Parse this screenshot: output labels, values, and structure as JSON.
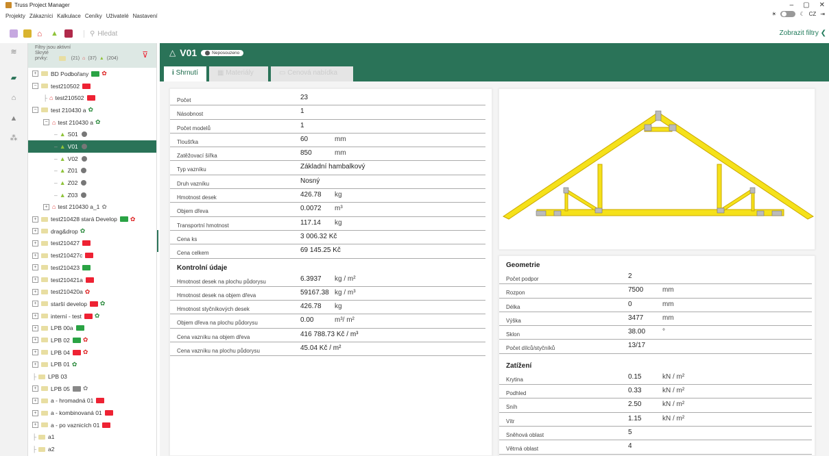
{
  "window": {
    "title": "Truss Project Manager",
    "min": "–",
    "max": "▢",
    "close": "✕"
  },
  "menu": [
    "Projekty",
    "Zákazníci",
    "Kalkulace",
    "Ceníky",
    "Uživatelé",
    "Nastavení"
  ],
  "menu_right": {
    "lang": "CZ"
  },
  "search": {
    "placeholder": "Hledat"
  },
  "filters_button": "Zobrazit filtry",
  "filter": {
    "line1": "Filtry jsou aktivní",
    "line2": "Skryté",
    "line3": "prvky:",
    "c1": "(21)",
    "c2": "(37)",
    "c3": "(204)"
  },
  "tree": [
    {
      "label": "BD Podbořany",
      "depth": 0,
      "type": "folder",
      "pm": "+",
      "badges": [
        "g",
        "gear-r"
      ]
    },
    {
      "label": "test210502",
      "depth": 0,
      "type": "folder",
      "pm": "−",
      "badges": [
        "r"
      ]
    },
    {
      "label": "test210502",
      "depth": 1,
      "type": "house",
      "pm": "",
      "badges": [
        "r"
      ]
    },
    {
      "label": "test 210430 a",
      "depth": 0,
      "type": "folder",
      "pm": "−",
      "badges": [
        "gear"
      ]
    },
    {
      "label": "test 210430 a",
      "depth": 1,
      "type": "house",
      "pm": "−",
      "badges": [
        "gear"
      ]
    },
    {
      "label": "S01",
      "depth": 2,
      "type": "tri",
      "pm": "",
      "badges": [
        "dot"
      ]
    },
    {
      "label": "V01",
      "depth": 2,
      "type": "tri",
      "pm": "",
      "badges": [
        "dot"
      ],
      "selected": true
    },
    {
      "label": "V02",
      "depth": 2,
      "type": "tri",
      "pm": "",
      "badges": [
        "dot"
      ]
    },
    {
      "label": "Z01",
      "depth": 2,
      "type": "tri",
      "pm": "",
      "badges": [
        "dot"
      ]
    },
    {
      "label": "Z02",
      "depth": 2,
      "type": "tri",
      "pm": "",
      "badges": [
        "dot"
      ]
    },
    {
      "label": "Z03",
      "depth": 2,
      "type": "tri",
      "pm": "",
      "badges": [
        "dot"
      ]
    },
    {
      "label": "test 210430 a_1",
      "depth": 1,
      "type": "house",
      "pm": "+",
      "badges": [
        "gear-gr"
      ]
    },
    {
      "label": "test210428 stará Develop",
      "depth": 0,
      "type": "folder",
      "pm": "+",
      "badges": [
        "g",
        "gear-r"
      ]
    },
    {
      "label": "drag&drop",
      "depth": 0,
      "type": "folder",
      "pm": "+",
      "badges": [
        "gear"
      ]
    },
    {
      "label": "test210427",
      "depth": 0,
      "type": "folder",
      "pm": "+",
      "badges": [
        "r"
      ]
    },
    {
      "label": "test210427c",
      "depth": 0,
      "type": "folder",
      "pm": "+",
      "badges": [
        "r"
      ]
    },
    {
      "label": "test210423",
      "depth": 0,
      "type": "folder",
      "pm": "+",
      "badges": [
        "g"
      ]
    },
    {
      "label": "test210421a",
      "depth": 0,
      "type": "folder",
      "pm": "+",
      "badges": [
        "r"
      ]
    },
    {
      "label": "test210420a",
      "depth": 0,
      "type": "folder",
      "pm": "+",
      "badges": [
        "gear-r"
      ]
    },
    {
      "label": "starší develop",
      "depth": 0,
      "type": "folder",
      "pm": "+",
      "badges": [
        "r",
        "gear"
      ]
    },
    {
      "label": "interní - test",
      "depth": 0,
      "type": "folder",
      "pm": "+",
      "badges": [
        "r",
        "gear"
      ]
    },
    {
      "label": "LPB 00a",
      "depth": 0,
      "type": "folder",
      "pm": "+",
      "badges": [
        "g"
      ]
    },
    {
      "label": "LPB 02",
      "depth": 0,
      "type": "folder",
      "pm": "+",
      "badges": [
        "g",
        "gear-r"
      ]
    },
    {
      "label": "LPB 04",
      "depth": 0,
      "type": "folder",
      "pm": "+",
      "badges": [
        "r",
        "gear-r"
      ]
    },
    {
      "label": "LPB 01",
      "depth": 0,
      "type": "folder",
      "pm": "+",
      "badges": [
        "gear"
      ]
    },
    {
      "label": "LPB 03",
      "depth": 0,
      "type": "folder",
      "pm": "",
      "badges": []
    },
    {
      "label": "LPB 05",
      "depth": 0,
      "type": "folder",
      "pm": "+",
      "badges": [
        "gr",
        "gear-gr"
      ]
    },
    {
      "label": "a - hromadná 01",
      "depth": 0,
      "type": "folder",
      "pm": "+",
      "badges": [
        "r"
      ]
    },
    {
      "label": "a - kombinovaná 01",
      "depth": 0,
      "type": "folder",
      "pm": "+",
      "badges": [
        "r"
      ]
    },
    {
      "label": "a - po vaznicích 01",
      "depth": 0,
      "type": "folder",
      "pm": "+",
      "badges": [
        "r"
      ]
    },
    {
      "label": "a1",
      "depth": 0,
      "type": "folder",
      "pm": "",
      "badges": []
    },
    {
      "label": "a2",
      "depth": 0,
      "type": "folder",
      "pm": "",
      "badges": []
    }
  ],
  "header": {
    "title": "V01",
    "status": "Neposouzeno"
  },
  "tabs": [
    {
      "label": "Shrnutí",
      "active": true
    },
    {
      "label": "Materiály"
    },
    {
      "label": "Cenová nabídka"
    }
  ],
  "summary": [
    {
      "k": "Počet",
      "v": "23",
      "u": ""
    },
    {
      "k": "Násobnost",
      "v": "1",
      "u": ""
    },
    {
      "k": "Počet modelů",
      "v": "1",
      "u": ""
    },
    {
      "k": "Tloušťka",
      "v": "60",
      "u": "mm"
    },
    {
      "k": "Zatěžovací šířka",
      "v": "850",
      "u": "mm"
    },
    {
      "k": "Typ vazníku",
      "v": "Základní hambalkový",
      "u": ""
    },
    {
      "k": "Druh vazníku",
      "v": "Nosný",
      "u": ""
    },
    {
      "k": "Hmotnost desek",
      "v": "426.78",
      "u": "kg"
    },
    {
      "k": "Objem dřeva",
      "v": "0.0072",
      "u": "m³"
    },
    {
      "k": "Transportní hmotnost",
      "v": "117.14",
      "u": "kg"
    },
    {
      "k": "Cena ks",
      "v": "3 006.32  Kč",
      "u": ""
    },
    {
      "k": "Cena celkem",
      "v": "69 145.25  Kč",
      "u": ""
    }
  ],
  "control_title": "Kontrolní údaje",
  "control": [
    {
      "k": "Hmotnost desek na plochu půdorysu",
      "v": "6.3937",
      "u": "kg / m²"
    },
    {
      "k": "Hmotnost desek na objem dřeva",
      "v": "59167.38",
      "u": "kg / m³"
    },
    {
      "k": "Hmotnost styčníkových desek",
      "v": "426.78",
      "u": "kg"
    },
    {
      "k": "Objem dřeva na plochu půdorysu",
      "v": "0.00",
      "u": "m³/ m²"
    },
    {
      "k": "Cena vazníku na objem dřeva",
      "v": "416 788.73  Kč / m³",
      "u": ""
    },
    {
      "k": "Cena vazníku na plochu půdorysu",
      "v": "45.04  Kč / m²",
      "u": ""
    }
  ],
  "geometry_title": "Geometrie",
  "geometry": [
    {
      "k": "Počet podpor",
      "v": "2",
      "u": ""
    },
    {
      "k": "Rozpon",
      "v": "7500",
      "u": "mm"
    },
    {
      "k": "Délka",
      "v": "0",
      "u": "mm"
    },
    {
      "k": "Výška",
      "v": "3477",
      "u": "mm"
    },
    {
      "k": "Sklon",
      "v": "38.00",
      "u": "°"
    },
    {
      "k": "Počet dílců/styčníků",
      "v": "13/17",
      "u": ""
    }
  ],
  "load_title": "Zatížení",
  "load": [
    {
      "k": "Krytina",
      "v": "0.15",
      "u": "kN / m²"
    },
    {
      "k": "Podhled",
      "v": "0.33",
      "u": "kN / m²"
    },
    {
      "k": "Sníh",
      "v": "2.50",
      "u": "kN / m²"
    },
    {
      "k": "Vítr",
      "v": "1.15",
      "u": "kN / m²"
    },
    {
      "k": "Sněhová oblast",
      "v": "5",
      "u": ""
    },
    {
      "k": "Větrná oblast",
      "v": "4",
      "u": ""
    }
  ]
}
